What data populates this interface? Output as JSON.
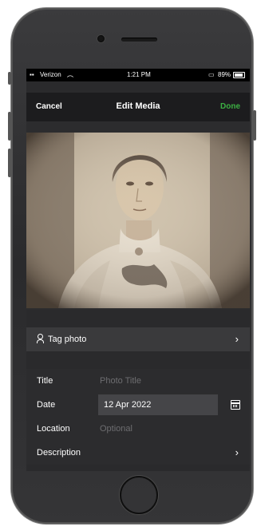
{
  "status_bar": {
    "carrier": "Verizon",
    "time": "1:21 PM",
    "battery": "89%"
  },
  "nav": {
    "cancel": "Cancel",
    "title": "Edit Media",
    "done": "Done",
    "done_color": "#3cb043"
  },
  "tag_photo": {
    "label": "Tag photo",
    "icon": "person-icon"
  },
  "form": {
    "title": {
      "label": "Title",
      "placeholder": "Photo Title"
    },
    "date": {
      "label": "Date",
      "value": "12 Apr 2022",
      "icon": "calendar-icon"
    },
    "location": {
      "label": "Location",
      "placeholder": "Optional"
    },
    "description": {
      "label": "Description"
    }
  }
}
